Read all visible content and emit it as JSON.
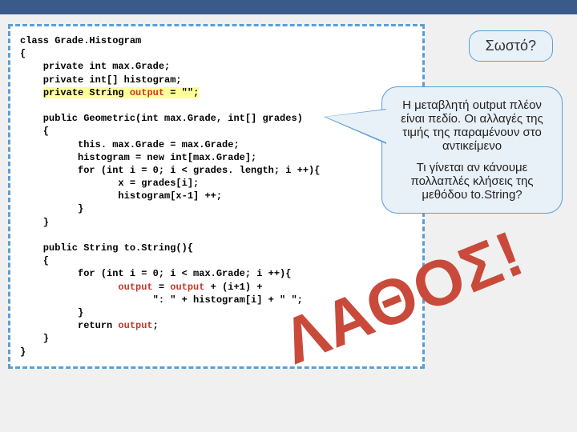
{
  "code": {
    "l1": "class Grade.Histogram",
    "l2": "{",
    "l3": "    private int max.Grade;",
    "l4": "    private int[] histogram;",
    "l5a": "    ",
    "l5b": "private String ",
    "l5c": "output",
    "l5d": " = \"\";",
    "l6": "",
    "l7": "    public Geometric(int max.Grade, int[] grades)",
    "l8": "    {",
    "l9": "          this. max.Grade = max.Grade;",
    "l10": "          histogram = new int[max.Grade];",
    "l11": "          for (int i = 0; i < grades. length; i ++){",
    "l12": "                 x = grades[i];",
    "l13": "                 histogram[x-1] ++;",
    "l14": "          }",
    "l15": "    }",
    "l16": "",
    "l17": "    public String to.String(){",
    "l18": "    {",
    "l19": "          for (int i = 0; i < max.Grade; i ++){",
    "l20a": "                 ",
    "l20b": "output",
    "l20c": " = ",
    "l20d": "output",
    "l20e": " + (i+1) +",
    "l21": "                       \": \" + histogram[i] + \" \";",
    "l22": "          }",
    "l23a": "          return ",
    "l23b": "output",
    "l23c": ";",
    "l24": "    }",
    "l25": "}"
  },
  "question": "Σωστό?",
  "callout": {
    "p1": "Η μεταβλητή output πλέον είναι πεδίο. Οι αλλαγές της τιμής της παραμένουν στο αντικείμενο",
    "p2": "Τι γίνεται αν κάνουμε πολλαπλές κλήσεις της μεθόδου to.String?"
  },
  "stamp": "ΛΑΘΟΣ!"
}
